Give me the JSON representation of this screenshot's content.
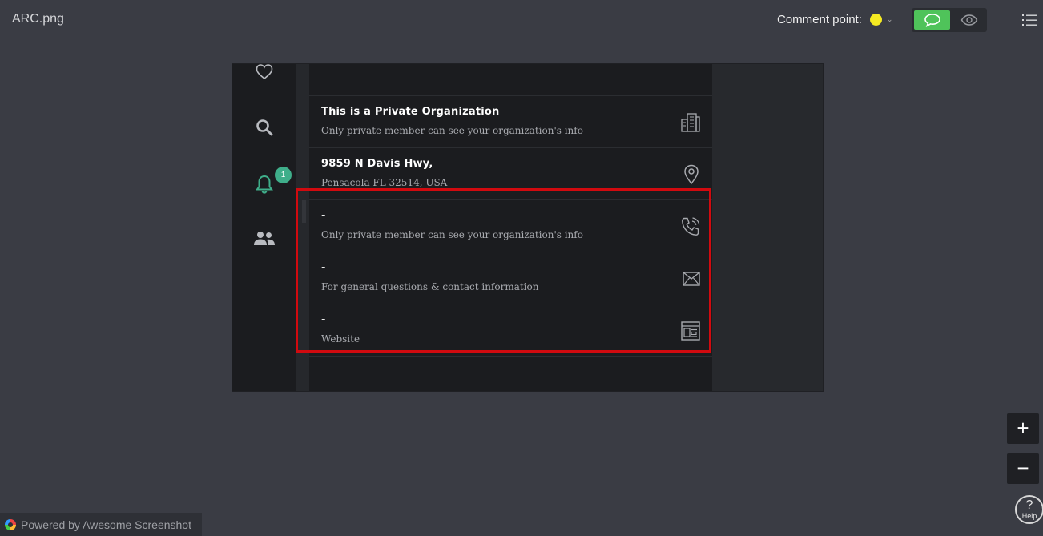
{
  "header": {
    "file_title": "ARC.png",
    "comment_point_label": "Comment point:",
    "comment_point_color": "#f5ea22",
    "mode_active_color": "#4fc35a"
  },
  "sidebar": {
    "icons": [
      "heart-icon",
      "search-icon",
      "bell-icon",
      "users-icon"
    ],
    "notification_count": "1",
    "notification_color": "#3fae8a"
  },
  "org_panel": {
    "rows": [
      {
        "title": "This is a Private Organization",
        "subtitle": "Only private member can see your organization's info",
        "icon": "building-icon"
      },
      {
        "title": "9859 N Davis Hwy,",
        "subtitle": "Pensacola FL 32514, USA",
        "icon": "location-pin-icon"
      },
      {
        "title": "-",
        "subtitle": "Only private member can see your organization's info",
        "icon": "phone-icon"
      },
      {
        "title": "-",
        "subtitle": "For general questions & contact information",
        "icon": "mail-icon"
      },
      {
        "title": "-",
        "subtitle": "Website",
        "icon": "website-icon"
      }
    ]
  },
  "highlight_color": "#d10a0f",
  "controls": {
    "zoom_in": "+",
    "zoom_out": "−",
    "help_symbol": "?",
    "help_label": "Help"
  },
  "footer": {
    "powered_by": "Powered by Awesome Screenshot"
  }
}
